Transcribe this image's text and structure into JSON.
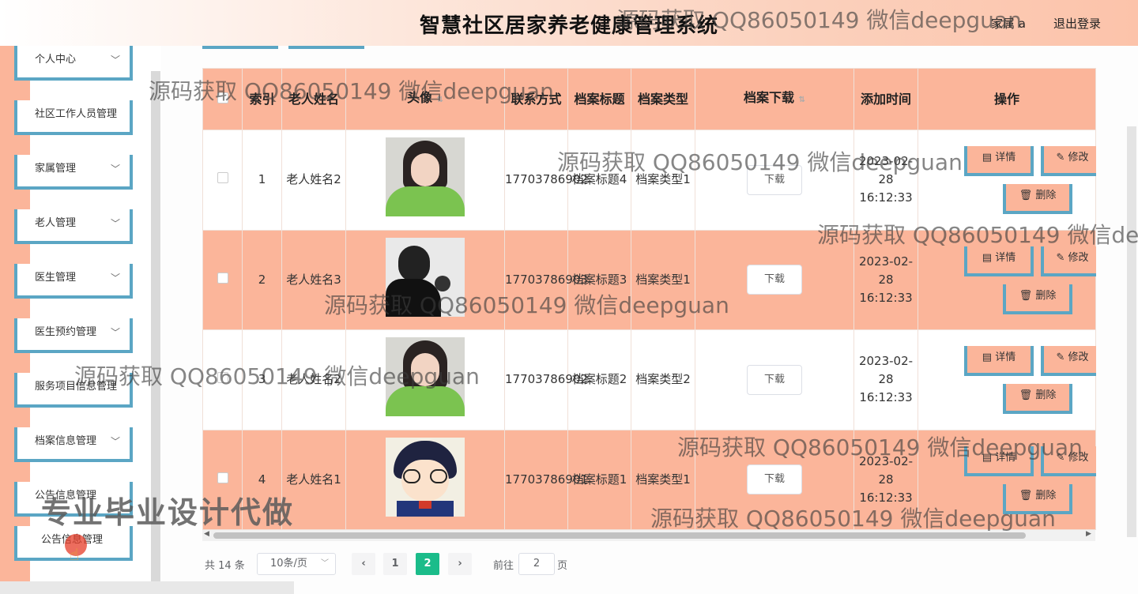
{
  "header": {
    "title": "智慧社区居家养老健康管理系统",
    "user": "家属 a",
    "logout": "退出登录"
  },
  "sidebar": {
    "items": [
      {
        "label": "个人中心",
        "chevron": "﹀"
      },
      {
        "label": "社区工作人员管理",
        "chevron": ""
      },
      {
        "label": "家属管理",
        "chevron": "﹀"
      },
      {
        "label": "老人管理",
        "chevron": "﹀"
      },
      {
        "label": "医生管理",
        "chevron": "﹀"
      },
      {
        "label": "医生预约管理",
        "chevron": "﹀"
      },
      {
        "label": "服务项目信息管理",
        "chevron": ""
      },
      {
        "label": "档案信息管理",
        "chevron": "﹀"
      },
      {
        "label": "公告信息管理",
        "chevron": ""
      },
      {
        "label": "公告信息管理",
        "chevron": ""
      }
    ]
  },
  "table": {
    "headers": {
      "index": "索引",
      "name": "老人姓名",
      "avatar": "头像",
      "phone": "联系方式",
      "title": "档案标题",
      "type": "档案类型",
      "download": "档案下载",
      "time": "添加时间",
      "ops": "操作"
    },
    "rows": [
      {
        "index": "1",
        "name": "老人姓名2",
        "avatar": "girl-photo",
        "phone": "17703786902",
        "title": "档案标题4",
        "type": "档案类型1",
        "download": "下载",
        "time": "2023-02-28 16:12:33"
      },
      {
        "index": "2",
        "name": "老人姓名3",
        "avatar": "man-silhouette-photo",
        "phone": "17703786903",
        "title": "档案标题3",
        "type": "档案类型1",
        "download": "下载",
        "time": "2023-02-28 16:12:33"
      },
      {
        "index": "3",
        "name": "老人姓名2",
        "avatar": "girl-photo",
        "phone": "17703786902",
        "title": "档案标题2",
        "type": "档案类型2",
        "download": "下载",
        "time": "2023-02-28 16:12:33"
      },
      {
        "index": "4",
        "name": "老人姓名1",
        "avatar": "anime-boy-photo",
        "phone": "17703786901",
        "title": "档案标题1",
        "type": "档案类型1",
        "download": "下载",
        "time": "2023-02-28 16:12:33"
      }
    ],
    "ops": {
      "detail": "详情",
      "edit": "修改",
      "delete": "删除"
    }
  },
  "pagination": {
    "total": "共 14 条",
    "page_size": "10条/页",
    "prev": "‹",
    "next": "›",
    "pages": [
      "1",
      "2"
    ],
    "current": "2",
    "goto_label": "前往",
    "goto_value": "2",
    "page_label": "页"
  },
  "overlay": {
    "watermark": "源码获取 QQ86050149 微信deepguan",
    "promo": "专业毕业设计代做"
  },
  "colors": {
    "accent_salmon": "#fbb59a",
    "accent_blue": "#5ba6c4",
    "active_page": "#1bbc8a"
  }
}
